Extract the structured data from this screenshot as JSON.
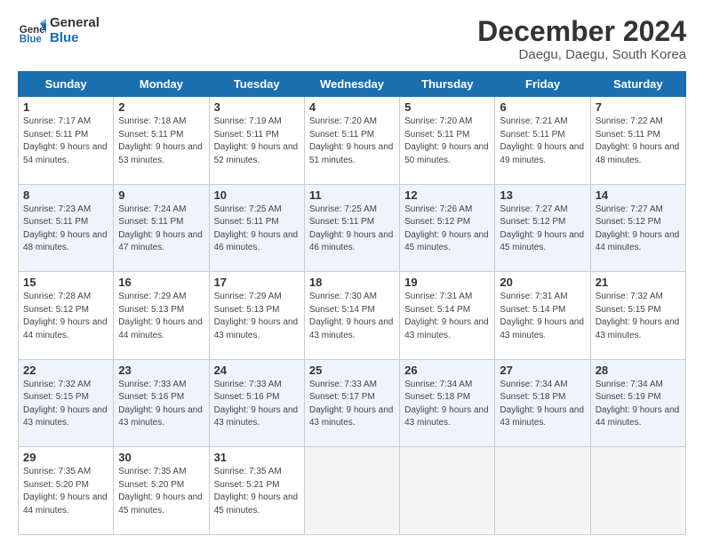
{
  "logo": {
    "line1": "General",
    "line2": "Blue"
  },
  "title": "December 2024",
  "subtitle": "Daegu, Daegu, South Korea",
  "headers": [
    "Sunday",
    "Monday",
    "Tuesday",
    "Wednesday",
    "Thursday",
    "Friday",
    "Saturday"
  ],
  "weeks": [
    [
      {
        "day": "1",
        "sunrise": "7:17 AM",
        "sunset": "5:11 PM",
        "daylight": "9 hours and 54 minutes."
      },
      {
        "day": "2",
        "sunrise": "7:18 AM",
        "sunset": "5:11 PM",
        "daylight": "9 hours and 53 minutes."
      },
      {
        "day": "3",
        "sunrise": "7:19 AM",
        "sunset": "5:11 PM",
        "daylight": "9 hours and 52 minutes."
      },
      {
        "day": "4",
        "sunrise": "7:20 AM",
        "sunset": "5:11 PM",
        "daylight": "9 hours and 51 minutes."
      },
      {
        "day": "5",
        "sunrise": "7:20 AM",
        "sunset": "5:11 PM",
        "daylight": "9 hours and 50 minutes."
      },
      {
        "day": "6",
        "sunrise": "7:21 AM",
        "sunset": "5:11 PM",
        "daylight": "9 hours and 49 minutes."
      },
      {
        "day": "7",
        "sunrise": "7:22 AM",
        "sunset": "5:11 PM",
        "daylight": "9 hours and 48 minutes."
      }
    ],
    [
      {
        "day": "8",
        "sunrise": "7:23 AM",
        "sunset": "5:11 PM",
        "daylight": "9 hours and 48 minutes."
      },
      {
        "day": "9",
        "sunrise": "7:24 AM",
        "sunset": "5:11 PM",
        "daylight": "9 hours and 47 minutes."
      },
      {
        "day": "10",
        "sunrise": "7:25 AM",
        "sunset": "5:11 PM",
        "daylight": "9 hours and 46 minutes."
      },
      {
        "day": "11",
        "sunrise": "7:25 AM",
        "sunset": "5:11 PM",
        "daylight": "9 hours and 46 minutes."
      },
      {
        "day": "12",
        "sunrise": "7:26 AM",
        "sunset": "5:12 PM",
        "daylight": "9 hours and 45 minutes."
      },
      {
        "day": "13",
        "sunrise": "7:27 AM",
        "sunset": "5:12 PM",
        "daylight": "9 hours and 45 minutes."
      },
      {
        "day": "14",
        "sunrise": "7:27 AM",
        "sunset": "5:12 PM",
        "daylight": "9 hours and 44 minutes."
      }
    ],
    [
      {
        "day": "15",
        "sunrise": "7:28 AM",
        "sunset": "5:12 PM",
        "daylight": "9 hours and 44 minutes."
      },
      {
        "day": "16",
        "sunrise": "7:29 AM",
        "sunset": "5:13 PM",
        "daylight": "9 hours and 44 minutes."
      },
      {
        "day": "17",
        "sunrise": "7:29 AM",
        "sunset": "5:13 PM",
        "daylight": "9 hours and 43 minutes."
      },
      {
        "day": "18",
        "sunrise": "7:30 AM",
        "sunset": "5:14 PM",
        "daylight": "9 hours and 43 minutes."
      },
      {
        "day": "19",
        "sunrise": "7:31 AM",
        "sunset": "5:14 PM",
        "daylight": "9 hours and 43 minutes."
      },
      {
        "day": "20",
        "sunrise": "7:31 AM",
        "sunset": "5:14 PM",
        "daylight": "9 hours and 43 minutes."
      },
      {
        "day": "21",
        "sunrise": "7:32 AM",
        "sunset": "5:15 PM",
        "daylight": "9 hours and 43 minutes."
      }
    ],
    [
      {
        "day": "22",
        "sunrise": "7:32 AM",
        "sunset": "5:15 PM",
        "daylight": "9 hours and 43 minutes."
      },
      {
        "day": "23",
        "sunrise": "7:33 AM",
        "sunset": "5:16 PM",
        "daylight": "9 hours and 43 minutes."
      },
      {
        "day": "24",
        "sunrise": "7:33 AM",
        "sunset": "5:16 PM",
        "daylight": "9 hours and 43 minutes."
      },
      {
        "day": "25",
        "sunrise": "7:33 AM",
        "sunset": "5:17 PM",
        "daylight": "9 hours and 43 minutes."
      },
      {
        "day": "26",
        "sunrise": "7:34 AM",
        "sunset": "5:18 PM",
        "daylight": "9 hours and 43 minutes."
      },
      {
        "day": "27",
        "sunrise": "7:34 AM",
        "sunset": "5:18 PM",
        "daylight": "9 hours and 43 minutes."
      },
      {
        "day": "28",
        "sunrise": "7:34 AM",
        "sunset": "5:19 PM",
        "daylight": "9 hours and 44 minutes."
      }
    ],
    [
      {
        "day": "29",
        "sunrise": "7:35 AM",
        "sunset": "5:20 PM",
        "daylight": "9 hours and 44 minutes."
      },
      {
        "day": "30",
        "sunrise": "7:35 AM",
        "sunset": "5:20 PM",
        "daylight": "9 hours and 45 minutes."
      },
      {
        "day": "31",
        "sunrise": "7:35 AM",
        "sunset": "5:21 PM",
        "daylight": "9 hours and 45 minutes."
      },
      null,
      null,
      null,
      null
    ]
  ]
}
